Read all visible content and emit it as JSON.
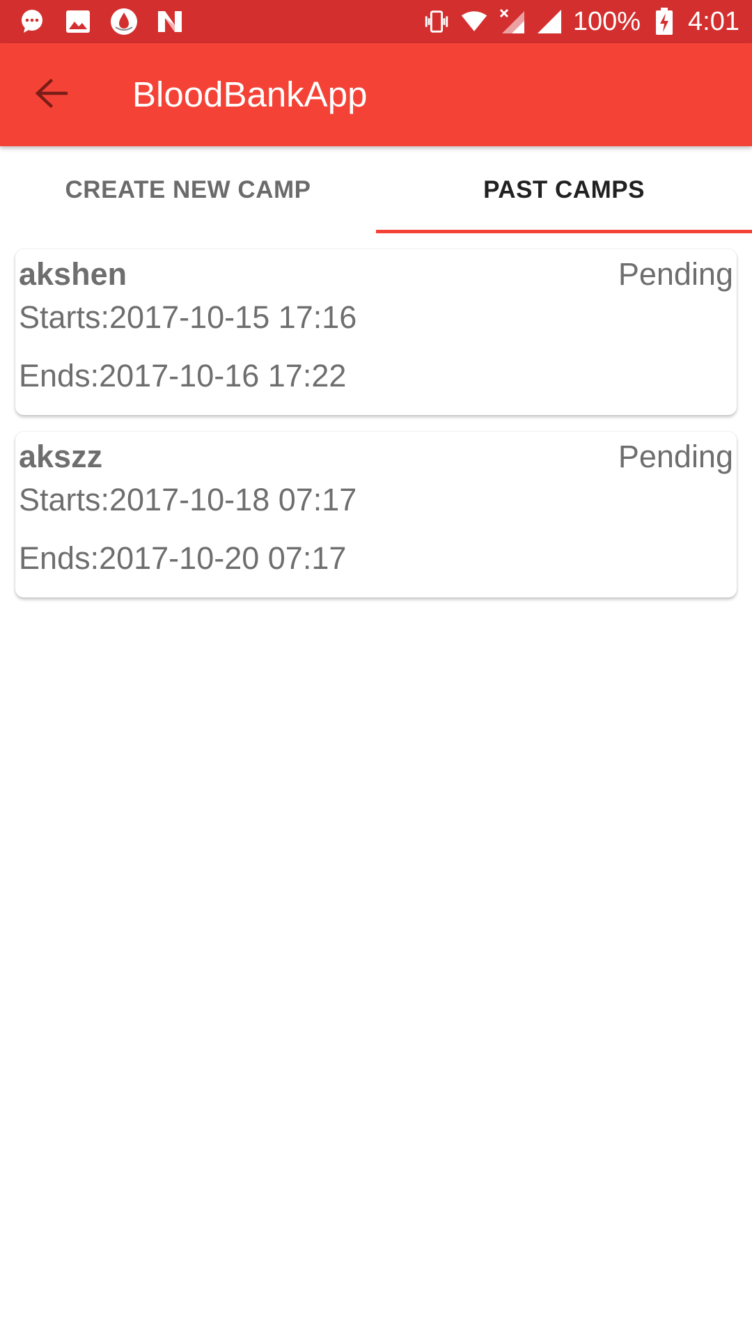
{
  "status_bar": {
    "battery": "100%",
    "time": "4:01",
    "left_icons": [
      "chat-bubble-icon",
      "image-icon",
      "blood-bank-app-icon",
      "n-logo-icon"
    ],
    "right_icons": [
      "vibrate-icon",
      "wifi-icon",
      "signal-no-data-icon",
      "signal-icon",
      "battery-charging-icon"
    ]
  },
  "app_bar": {
    "title": "BloodBankApp",
    "back_icon": "arrow-back-icon",
    "color": "#f44336"
  },
  "status_bar_color": "#d32f2f",
  "tabs": [
    {
      "label": "CREATE NEW CAMP",
      "active": false
    },
    {
      "label": "PAST CAMPS",
      "active": true
    }
  ],
  "camps": [
    {
      "name": "akshen",
      "status": "Pending",
      "starts": "Starts:2017-10-15 17:16",
      "ends": "Ends:2017-10-16 17:22"
    },
    {
      "name": "akszz",
      "status": "Pending",
      "starts": "Starts:2017-10-18 07:17",
      "ends": "Ends:2017-10-20 07:17"
    }
  ]
}
